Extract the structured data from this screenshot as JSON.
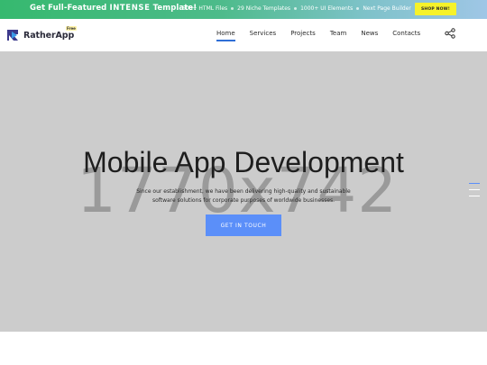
{
  "promo": {
    "title_prefix": "Get Full-Featured ",
    "title_strong": "INTENSE",
    "title_suffix": " Template!",
    "features": [
      "500+ HTML Files",
      "29 Niche Templates",
      "1000+ UI Elements",
      "Next Page Builder"
    ],
    "button_label": "SHOP NOW!"
  },
  "nav": {
    "logo_text": "RatherApp",
    "logo_badge": "Free",
    "items": [
      {
        "label": "Home",
        "active": true
      },
      {
        "label": "Services"
      },
      {
        "label": "Projects"
      },
      {
        "label": "Team"
      },
      {
        "label": "News"
      },
      {
        "label": "Contacts"
      }
    ],
    "share_icon": "share-icon"
  },
  "hero": {
    "placeholder": "1770x742",
    "title": "Mobile App Development",
    "text_line1": "Since our establishment, we have been delivering high-quality and sustainable",
    "text_line2": "software solutions for corporate purposes of worldwide businesses.",
    "button_label": "GET IN TOUCH",
    "accent_color": "#5b8ff9"
  }
}
